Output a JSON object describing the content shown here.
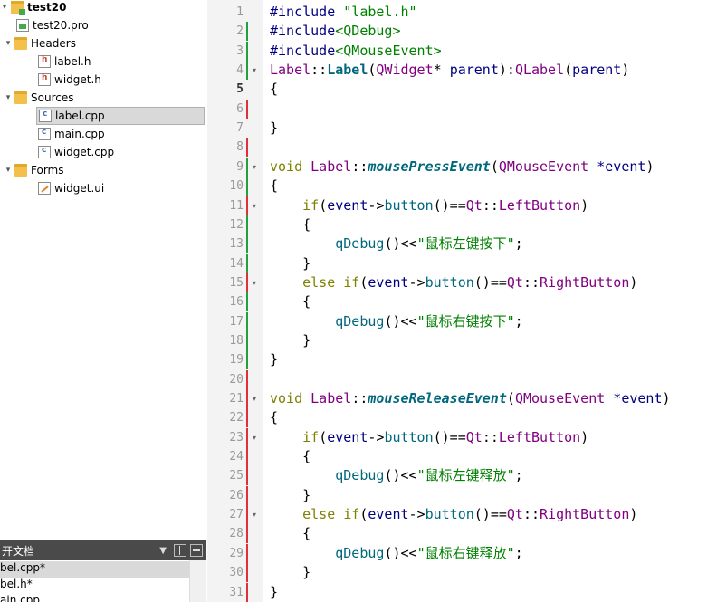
{
  "project_tree": {
    "project_name": "test20",
    "pro_file": "test20.pro",
    "headers_label": "Headers",
    "headers": [
      "label.h",
      "widget.h"
    ],
    "sources_label": "Sources",
    "sources": [
      "label.cpp",
      "main.cpp",
      "widget.cpp"
    ],
    "forms_label": "Forms",
    "forms": [
      "widget.ui"
    ],
    "selected": "label.cpp"
  },
  "open_documents": {
    "title": "开文档",
    "items": [
      "bel.cpp*",
      "bel.h*",
      "ain.cpp"
    ],
    "selected_index": 0
  },
  "editor": {
    "current_line": 5,
    "lines": [
      {
        "n": "1",
        "mark": "",
        "fold": ""
      },
      {
        "n": "2",
        "mark": "green",
        "fold": ""
      },
      {
        "n": "3",
        "mark": "green",
        "fold": ""
      },
      {
        "n": "4",
        "mark": "green",
        "fold": "▾"
      },
      {
        "n": "5",
        "mark": "",
        "fold": ""
      },
      {
        "n": "6",
        "mark": "red",
        "fold": ""
      },
      {
        "n": "7",
        "mark": "",
        "fold": ""
      },
      {
        "n": "8",
        "mark": "red",
        "fold": ""
      },
      {
        "n": "9",
        "mark": "green",
        "fold": "▾"
      },
      {
        "n": "10",
        "mark": "green",
        "fold": ""
      },
      {
        "n": "11",
        "mark": "red",
        "fold": "▾"
      },
      {
        "n": "12",
        "mark": "green",
        "fold": ""
      },
      {
        "n": "13",
        "mark": "green",
        "fold": ""
      },
      {
        "n": "14",
        "mark": "green",
        "fold": ""
      },
      {
        "n": "15",
        "mark": "red",
        "fold": "▾"
      },
      {
        "n": "16",
        "mark": "green",
        "fold": ""
      },
      {
        "n": "17",
        "mark": "green",
        "fold": ""
      },
      {
        "n": "18",
        "mark": "green",
        "fold": ""
      },
      {
        "n": "19",
        "mark": "green",
        "fold": ""
      },
      {
        "n": "20",
        "mark": "red",
        "fold": ""
      },
      {
        "n": "21",
        "mark": "red",
        "fold": "▾"
      },
      {
        "n": "22",
        "mark": "red",
        "fold": ""
      },
      {
        "n": "23",
        "mark": "red",
        "fold": "▾"
      },
      {
        "n": "24",
        "mark": "red",
        "fold": ""
      },
      {
        "n": "25",
        "mark": "red",
        "fold": ""
      },
      {
        "n": "26",
        "mark": "red",
        "fold": ""
      },
      {
        "n": "27",
        "mark": "red",
        "fold": "▾"
      },
      {
        "n": "28",
        "mark": "red",
        "fold": ""
      },
      {
        "n": "29",
        "mark": "red",
        "fold": ""
      },
      {
        "n": "30",
        "mark": "red",
        "fold": ""
      },
      {
        "n": "31",
        "mark": "red",
        "fold": ""
      }
    ],
    "code": [
      [
        [
          "pp",
          "#include "
        ],
        [
          "str",
          "\"label.h\""
        ]
      ],
      [
        [
          "pp",
          "#include"
        ],
        [
          "str",
          "<QDebug>"
        ]
      ],
      [
        [
          "pp",
          "#include"
        ],
        [
          "str",
          "<QMouseEvent>"
        ]
      ],
      [
        [
          "typ",
          "Label"
        ],
        [
          "",
          "::"
        ],
        [
          "fnb",
          "Label"
        ],
        [
          "",
          "("
        ],
        [
          "typ",
          "QWidget"
        ],
        [
          "",
          "* "
        ],
        [
          "pp",
          "parent"
        ],
        [
          "",
          "):"
        ],
        [
          "typ",
          "QLabel"
        ],
        [
          "",
          "("
        ],
        [
          "pp",
          "parent"
        ],
        [
          "",
          ")"
        ]
      ],
      [
        [
          "",
          "{"
        ]
      ],
      [
        [
          "",
          ""
        ]
      ],
      [
        [
          "",
          "}"
        ]
      ],
      [
        [
          "",
          ""
        ]
      ],
      [
        [
          "kw",
          "void "
        ],
        [
          "typ",
          "Label"
        ],
        [
          "",
          "::"
        ],
        [
          "fni",
          "mousePressEvent"
        ],
        [
          "",
          "("
        ],
        [
          "typ",
          "QMouseEvent"
        ],
        [
          "pp",
          " *event"
        ],
        [
          "",
          ")"
        ]
      ],
      [
        [
          "",
          "{"
        ]
      ],
      [
        [
          "kw",
          "    if"
        ],
        [
          "",
          "("
        ],
        [
          "pp",
          "event"
        ],
        [
          "",
          "->"
        ],
        [
          "fn",
          "button"
        ],
        [
          "",
          "()=="
        ],
        [
          "typ",
          "Qt"
        ],
        [
          "",
          "::"
        ],
        [
          "typ",
          "LeftButton"
        ],
        [
          "",
          ")"
        ]
      ],
      [
        [
          "",
          "    {"
        ]
      ],
      [
        [
          "fn",
          "        qDebug"
        ],
        [
          "",
          "()<<"
        ],
        [
          "str",
          "\"鼠标左键按下\""
        ],
        [
          "",
          ";"
        ]
      ],
      [
        [
          "",
          "    }"
        ]
      ],
      [
        [
          "kw",
          "    else if"
        ],
        [
          "",
          "("
        ],
        [
          "pp",
          "event"
        ],
        [
          "",
          "->"
        ],
        [
          "fn",
          "button"
        ],
        [
          "",
          "()=="
        ],
        [
          "typ",
          "Qt"
        ],
        [
          "",
          "::"
        ],
        [
          "typ",
          "RightButton"
        ],
        [
          "",
          ")"
        ]
      ],
      [
        [
          "",
          "    {"
        ]
      ],
      [
        [
          "fn",
          "        qDebug"
        ],
        [
          "",
          "()<<"
        ],
        [
          "str",
          "\"鼠标右键按下\""
        ],
        [
          "",
          ";"
        ]
      ],
      [
        [
          "",
          "    }"
        ]
      ],
      [
        [
          "",
          "}"
        ]
      ],
      [
        [
          "",
          ""
        ]
      ],
      [
        [
          "kw",
          "void "
        ],
        [
          "typ",
          "Label"
        ],
        [
          "",
          "::"
        ],
        [
          "fni",
          "mouseReleaseEvent"
        ],
        [
          "",
          "("
        ],
        [
          "typ",
          "QMouseEvent"
        ],
        [
          "pp",
          " *event"
        ],
        [
          "",
          ")"
        ]
      ],
      [
        [
          "",
          "{"
        ]
      ],
      [
        [
          "kw",
          "    if"
        ],
        [
          "",
          "("
        ],
        [
          "pp",
          "event"
        ],
        [
          "",
          "->"
        ],
        [
          "fn",
          "button"
        ],
        [
          "",
          "()=="
        ],
        [
          "typ",
          "Qt"
        ],
        [
          "",
          "::"
        ],
        [
          "typ",
          "LeftButton"
        ],
        [
          "",
          ")"
        ]
      ],
      [
        [
          "",
          "    {"
        ]
      ],
      [
        [
          "fn",
          "        qDebug"
        ],
        [
          "",
          "()<<"
        ],
        [
          "str",
          "\"鼠标左键释放\""
        ],
        [
          "",
          ";"
        ]
      ],
      [
        [
          "",
          "    }"
        ]
      ],
      [
        [
          "kw",
          "    else if"
        ],
        [
          "",
          "("
        ],
        [
          "pp",
          "event"
        ],
        [
          "",
          "->"
        ],
        [
          "fn",
          "button"
        ],
        [
          "",
          "()=="
        ],
        [
          "typ",
          "Qt"
        ],
        [
          "",
          "::"
        ],
        [
          "typ",
          "RightButton"
        ],
        [
          "",
          ")"
        ]
      ],
      [
        [
          "",
          "    {"
        ]
      ],
      [
        [
          "fn",
          "        qDebug"
        ],
        [
          "",
          "()<<"
        ],
        [
          "str",
          "\"鼠标右键释放\""
        ],
        [
          "",
          ";"
        ]
      ],
      [
        [
          "",
          "    }"
        ]
      ],
      [
        [
          "",
          "}"
        ]
      ]
    ]
  },
  "colors": {
    "mark_green": "#21a03f",
    "mark_red": "#e0303a",
    "selection": "#d9d9d9",
    "open_docs_bar": "#4a4a4a"
  }
}
